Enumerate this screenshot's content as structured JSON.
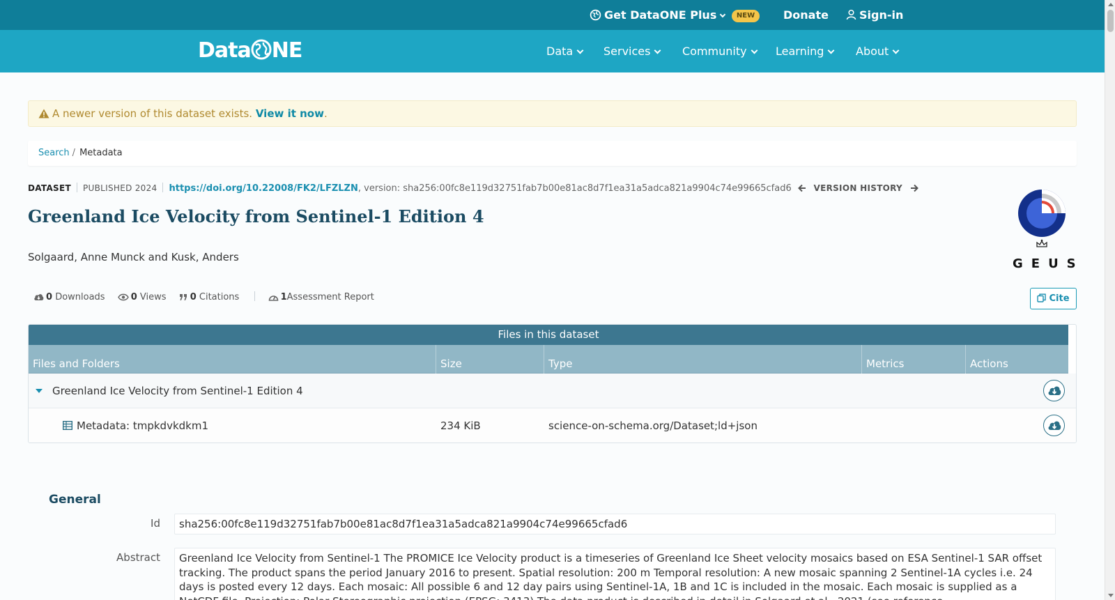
{
  "topbar": {
    "plus_label": "Get DataONE Plus",
    "new_badge": "NEW",
    "donate": "Donate",
    "sign_in": "Sign-in"
  },
  "nav": {
    "logo_text": "Data",
    "logo_text_after": "NE",
    "items": [
      {
        "label": "Data"
      },
      {
        "label": "Services"
      },
      {
        "label": "Community"
      },
      {
        "label": "Learning"
      },
      {
        "label": "About"
      }
    ]
  },
  "alert": {
    "text": "A newer version of this dataset exists.",
    "link": "View it now",
    "end": "."
  },
  "breadcrumb": {
    "search": "Search",
    "separator": "/",
    "current": "Metadata"
  },
  "dataset": {
    "type": "DATASET",
    "published": "PUBLISHED 2024",
    "doi": "https://doi.org/10.22008/FK2/LFZLZN",
    "version": ", version: sha256:00fc8e119d32751fab7b00e81ac8d7f1ea31a5adca821a9904c74e99665cfad6",
    "version_history": "VERSION HISTORY",
    "title": "Greenland Ice Velocity from Sentinel-1 Edition 4",
    "authors": "Solgaard, Anne Munck and Kusk, Anders",
    "logo_text": "GEUS",
    "cite_label": "Cite"
  },
  "metrics": {
    "downloads_count": "0",
    "downloads_label": "Downloads",
    "views_count": "0",
    "views_label": "Views",
    "citations_count": "0",
    "citations_label": "Citations",
    "assessment_count": "1",
    "assessment_label": "Assessment Report"
  },
  "files": {
    "title": "Files in this dataset",
    "columns": [
      "Files and Folders",
      "Size",
      "Type",
      "Metrics",
      "Actions"
    ],
    "rows": [
      {
        "name": "Greenland Ice Velocity from Sentinel-1 Edition 4",
        "size": "",
        "type": ""
      },
      {
        "name": "Metadata: tmpkdvkdkm1",
        "size": "234 KiB",
        "type": "science-on-schema.org/Dataset;ld+json"
      }
    ]
  },
  "general": {
    "title": "General",
    "id_label": "Id",
    "id_value": "sha256:00fc8e119d32751fab7b00e81ac8d7f1ea31a5adca821a9904c74e99665cfad6",
    "abstract_label": "Abstract",
    "abstract_value": "Greenland Ice Velocity from Sentinel-1 The PROMICE Ice Velocity product is a timeseries of Greenland Ice Sheet velocity mosaics based on ESA Sentinel-1 SAR offset tracking. The product spans the period January 2016 to present. Spatial resolution: 200 m Temporal resolution: A new mosaic spanning 2 Sentinel-1A cycles i.e. 24 days is posted every 12 days. Each mosaic: All possible 6 and 12 day pairs using Sentinel-1A, 1B and 1C is included in the mosaic. Each mosaic is supplied as a NetCDF file. Projection: Polar Stereographic projection (EPSG: 3413) The data product is described in detail in Solgaard et al., 2021 (see reference"
  },
  "colors": {
    "topbar": "#0f7e99",
    "navbar": "#1ea6c4",
    "accent": "#1a8fb0",
    "title": "#1b4b62",
    "table_header": "#3d7790"
  }
}
